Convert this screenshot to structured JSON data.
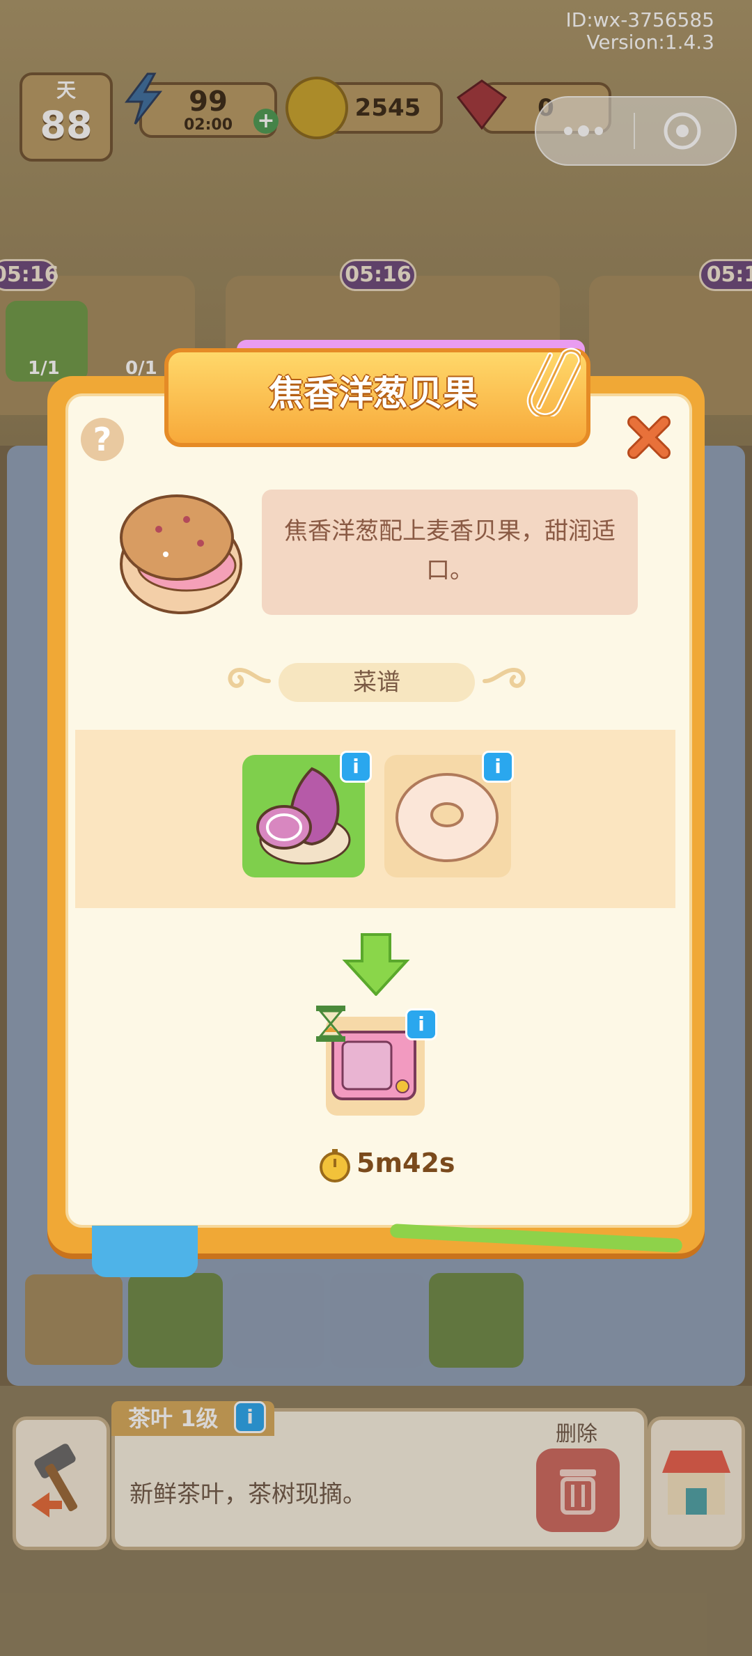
{
  "header": {
    "id_text": "ID:wx-3756585",
    "version_text": "Version:1.4.3"
  },
  "hud": {
    "day_label": "天",
    "day_value": "88",
    "energy_value": "99",
    "energy_timer": "02:00",
    "coins_value": "2545",
    "gems_value": "0"
  },
  "background": {
    "timer_left": "05:16",
    "timer_middle": "05:16",
    "timer_right": "05:1",
    "order_count_1": "1/1",
    "order_count_2": "0/1"
  },
  "dialog": {
    "title": "焦香洋葱贝果",
    "description": "焦香洋葱配上麦香贝果，甜润适口。",
    "recipe_label": "菜谱",
    "cook_time": "5m42s",
    "help_symbol": "?",
    "info_symbol": "i"
  },
  "bottom_bar": {
    "item_tag": "茶叶 1级",
    "item_description": "新鲜茶叶，茶树现摘。",
    "delete_label": "删除"
  },
  "colors": {
    "frame": "#f0a836",
    "panel": "#fdf8e6",
    "selected_ingredient": "#7fcf4c",
    "info_badge": "#2aa7ee"
  }
}
